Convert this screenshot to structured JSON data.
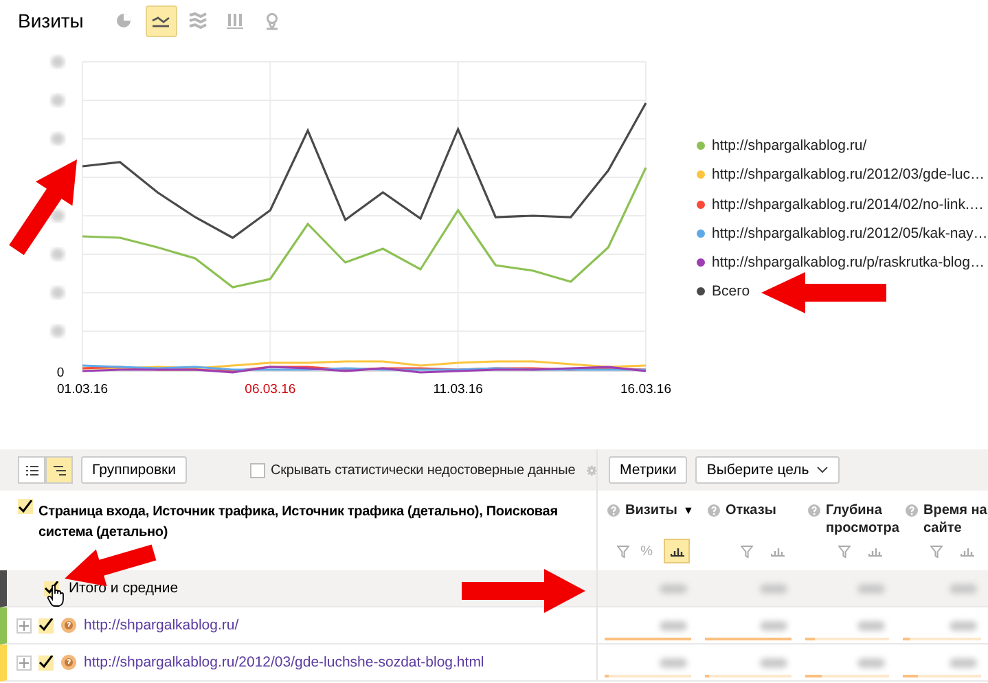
{
  "header": {
    "title": "Визиты",
    "chart_types": [
      {
        "kind": "pie",
        "selected": false
      },
      {
        "kind": "line",
        "selected": true
      },
      {
        "kind": "area",
        "selected": false
      },
      {
        "kind": "bar",
        "selected": false
      },
      {
        "kind": "map",
        "selected": false
      }
    ]
  },
  "chart": {
    "y_zero": "0",
    "x_labels": [
      {
        "label": "01.03.16",
        "weekend": false
      },
      {
        "label": "06.03.16",
        "weekend": true
      },
      {
        "label": "11.03.16",
        "weekend": false
      },
      {
        "label": "16.03.16",
        "weekend": false
      }
    ],
    "legend": [
      {
        "label": "http://shpargalkablog.ru/",
        "color": "#8dc153"
      },
      {
        "label": "http://shpargalkablog.ru/2012/03/gde-luc…",
        "color": "#fcc43e"
      },
      {
        "label": "http://shpargalkablog.ru/2014/02/no-link.…",
        "color": "#fa4a3a"
      },
      {
        "label": "http://shpargalkablog.ru/2012/05/kak-nay…",
        "color": "#5fa8e8"
      },
      {
        "label": "http://shpargalkablog.ru/p/raskrutka-blog…",
        "color": "#9d3fb3"
      },
      {
        "label": "Всего",
        "color": "#4a4a4a"
      }
    ]
  },
  "toolbar": {
    "view_modes": [
      {
        "kind": "list",
        "selected": false
      },
      {
        "kind": "tree",
        "selected": true
      }
    ],
    "groupings": "Группировки",
    "hide_unreliable": {
      "label": "Скрывать статистически недостоверные данные",
      "checked": false
    },
    "metrics": "Метрики",
    "goal": "Выберите цель"
  },
  "table": {
    "dimensions": {
      "label": "Страница входа, Источник трафика, Источник трафика (детально), Поисковая система (детально)",
      "checked": true
    },
    "columns": [
      {
        "label": "Визиты",
        "sort": "▼",
        "percent": "%",
        "chart_on": true
      },
      {
        "label": "Отказы",
        "chart_on": false
      },
      {
        "label": "Глубина просмотра",
        "chart_on": false
      },
      {
        "label": "Время на сайте",
        "chart_on": false
      }
    ],
    "rows": [
      {
        "kind": "total",
        "label": "Итого и средние",
        "checked": true,
        "color": "#4d4d4d"
      },
      {
        "kind": "page",
        "label": "http://shpargalkablog.ru/",
        "checked": true,
        "color": "#8dc153",
        "cells": [
          {
            "level": 1
          },
          {
            "level": 1
          },
          {
            "level": 0.12
          },
          {
            "level": 0.08
          }
        ]
      },
      {
        "kind": "page",
        "label": "http://shpargalkablog.ru/2012/03/gde-luchshe-sozdat-blog.html",
        "checked": true,
        "color": "#fcd84e",
        "cells": [
          {
            "level": 0.05
          },
          {
            "level": 0.05
          },
          {
            "level": 0.2
          },
          {
            "level": 0.2
          }
        ]
      }
    ]
  }
}
